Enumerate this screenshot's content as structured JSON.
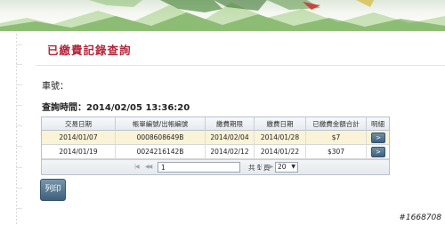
{
  "page": {
    "title": "已繳費記錄查詢",
    "car_label": "車號：",
    "query_time": "查詢時間：2014/02/05 13:36:20"
  },
  "table": {
    "headers": [
      "交易日期",
      "帳單編號/出帳編號",
      "繳費期限",
      "繳費日期",
      "已繳費金額合計",
      "明細"
    ],
    "rows": [
      {
        "date": "2014/01/07",
        "bill_no": "000860864​9B",
        "due": "2014/02/04",
        "paid_date": "2014/01/28",
        "amount": "$7",
        "detail": ">"
      },
      {
        "date": "2014/01/19",
        "bill_no": "0024216142B",
        "due": "2014/02/12",
        "paid_date": "2014/01/22",
        "amount": "$307",
        "detail": ">"
      }
    ]
  },
  "pager": {
    "first": "|◀",
    "prev": "◀◀",
    "current_page": "1",
    "page_of": "共 1 頁",
    "next": "▶▶",
    "last": "▶|",
    "page_size": "20"
  },
  "actions": {
    "print": "列印"
  },
  "watermark": "#1668708",
  "colors": {
    "title": "#b4263a",
    "selected_row": "#fbf3d7",
    "button": "#4a6a86"
  }
}
